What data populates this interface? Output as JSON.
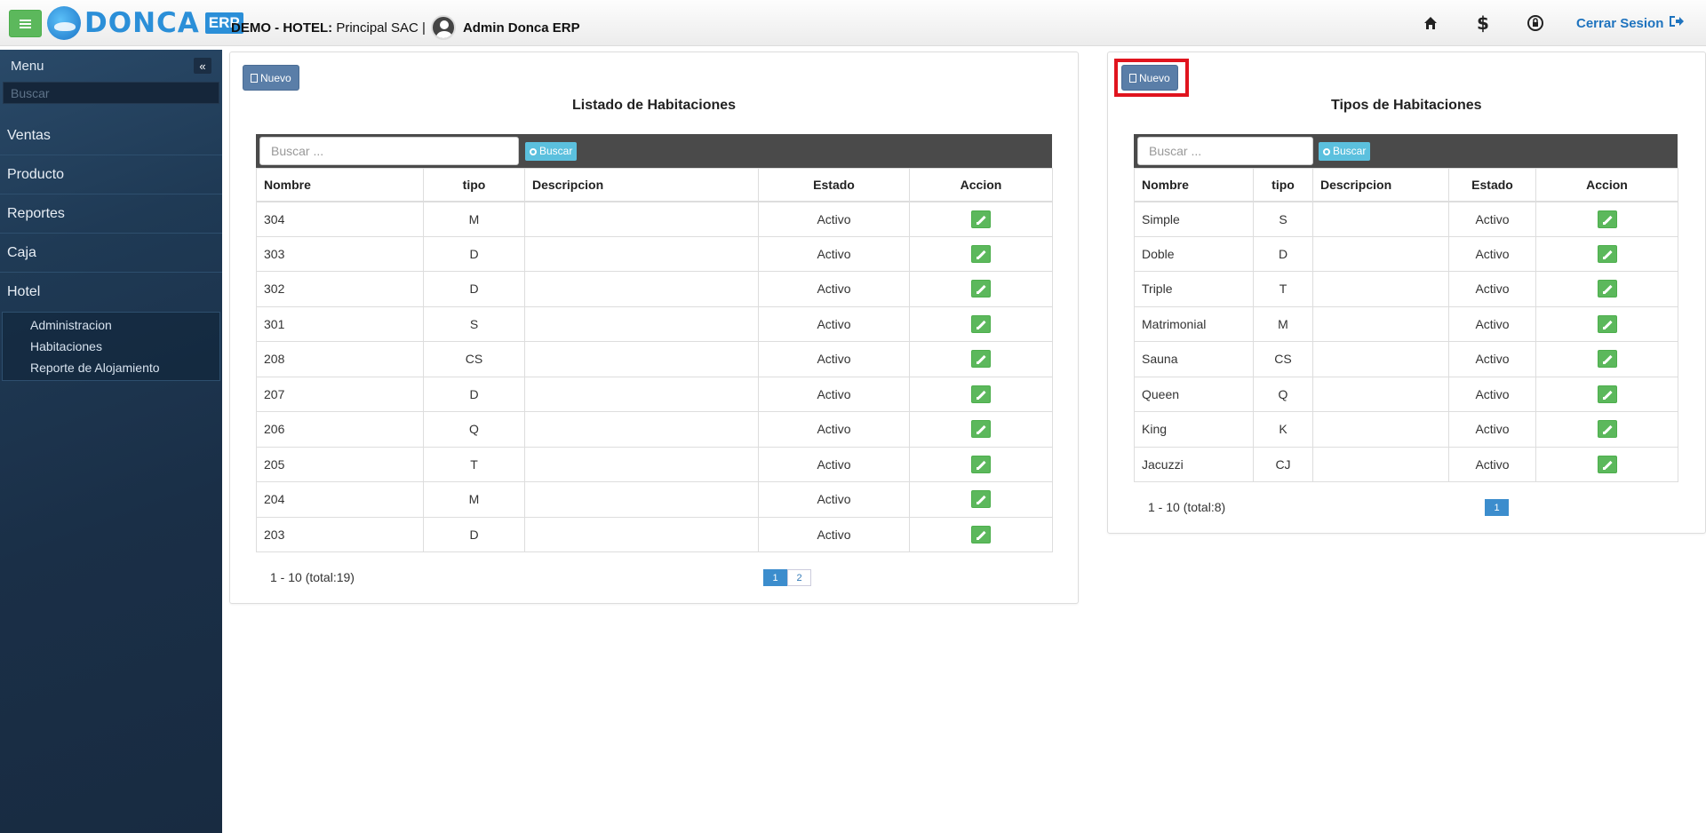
{
  "header": {
    "logo_text": "DONCA",
    "logo_badge": "ERP",
    "company_label": "DEMO - HOTEL:",
    "company_name": "Principal SAC |",
    "user_name": "Admin Donca ERP",
    "logout_label": "Cerrar Sesion",
    "icons": [
      "home-icon",
      "dollar-icon",
      "lock-icon",
      "sign-out-icon"
    ]
  },
  "sidebar": {
    "title": "Menu",
    "search_placeholder": "Buscar",
    "items": [
      {
        "label": "Ventas"
      },
      {
        "label": "Producto"
      },
      {
        "label": "Reportes"
      },
      {
        "label": "Caja"
      },
      {
        "label": "Hotel"
      }
    ],
    "subitems": [
      {
        "label": "Administracion"
      },
      {
        "label": "Habitaciones"
      },
      {
        "label": "Reporte de Alojamiento"
      }
    ]
  },
  "rooms": {
    "new_label": "Nuevo",
    "title": "Listado de Habitaciones",
    "search_placeholder": "Buscar ...",
    "search_button": "Buscar",
    "columns": [
      "Nombre",
      "tipo",
      "Descripcion",
      "Estado",
      "Accion"
    ],
    "rows": [
      {
        "nombre": "304",
        "tipo": "M",
        "descripcion": "",
        "estado": "Activo"
      },
      {
        "nombre": "303",
        "tipo": "D",
        "descripcion": "",
        "estado": "Activo"
      },
      {
        "nombre": "302",
        "tipo": "D",
        "descripcion": "",
        "estado": "Activo"
      },
      {
        "nombre": "301",
        "tipo": "S",
        "descripcion": "",
        "estado": "Activo"
      },
      {
        "nombre": "208",
        "tipo": "CS",
        "descripcion": "",
        "estado": "Activo"
      },
      {
        "nombre": "207",
        "tipo": "D",
        "descripcion": "",
        "estado": "Activo"
      },
      {
        "nombre": "206",
        "tipo": "Q",
        "descripcion": "",
        "estado": "Activo"
      },
      {
        "nombre": "205",
        "tipo": "T",
        "descripcion": "",
        "estado": "Activo"
      },
      {
        "nombre": "204",
        "tipo": "M",
        "descripcion": "",
        "estado": "Activo"
      },
      {
        "nombre": "203",
        "tipo": "D",
        "descripcion": "",
        "estado": "Activo"
      }
    ],
    "pager_info": "1 - 10 (total:19)",
    "pages": [
      "1",
      "2"
    ],
    "active_page": "1"
  },
  "types": {
    "new_label": "Nuevo",
    "title": "Tipos de Habitaciones",
    "search_placeholder": "Buscar ...",
    "search_button": "Buscar",
    "columns": [
      "Nombre",
      "tipo",
      "Descripcion",
      "Estado",
      "Accion"
    ],
    "rows": [
      {
        "nombre": "Simple",
        "tipo": "S",
        "descripcion": "",
        "estado": "Activo"
      },
      {
        "nombre": "Doble",
        "tipo": "D",
        "descripcion": "",
        "estado": "Activo"
      },
      {
        "nombre": "Triple",
        "tipo": "T",
        "descripcion": "",
        "estado": "Activo"
      },
      {
        "nombre": "Matrimonial",
        "tipo": "M",
        "descripcion": "",
        "estado": "Activo"
      },
      {
        "nombre": "Sauna",
        "tipo": "CS",
        "descripcion": "",
        "estado": "Activo"
      },
      {
        "nombre": "Queen",
        "tipo": "Q",
        "descripcion": "",
        "estado": "Activo"
      },
      {
        "nombre": "King",
        "tipo": "K",
        "descripcion": "",
        "estado": "Activo"
      },
      {
        "nombre": "Jacuzzi",
        "tipo": "CJ",
        "descripcion": "",
        "estado": "Activo"
      }
    ],
    "pager_info": "1 - 10 (total:8)",
    "pages": [
      "1"
    ],
    "active_page": "1"
  },
  "colors": {
    "accent_green": "#5cb85c",
    "button_blue": "#5a7ea8",
    "search_blue": "#5bc0de",
    "highlight_red": "#e0141e",
    "sidebar_bg": "#1f3a55"
  }
}
